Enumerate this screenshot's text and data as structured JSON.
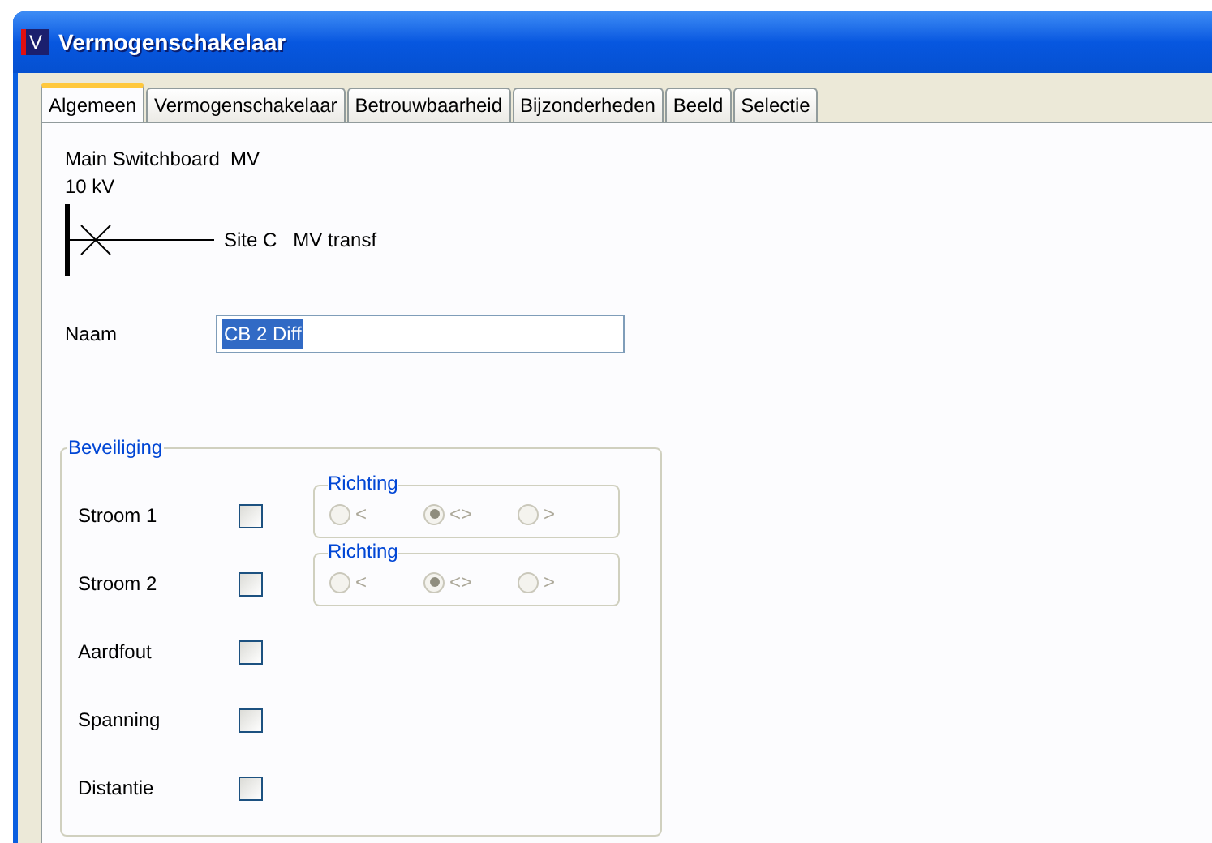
{
  "window": {
    "icon_letter": "V",
    "title": "Vermogenschakelaar"
  },
  "tabs": [
    {
      "label": "Algemeen",
      "selected": true
    },
    {
      "label": "Vermogenschakelaar",
      "selected": false
    },
    {
      "label": "Betrouwbaarheid",
      "selected": false
    },
    {
      "label": "Bijzonderheden",
      "selected": false
    },
    {
      "label": "Beeld",
      "selected": false
    },
    {
      "label": "Selectie",
      "selected": false
    }
  ],
  "header": {
    "switchboard": "Main Switchboard  MV",
    "voltage": "10 kV",
    "connection": "Site C   MV transf"
  },
  "naam": {
    "label": "Naam",
    "value": "CB 2 Diff"
  },
  "beveiliging": {
    "title": "Beveiliging",
    "rows": [
      {
        "label": "Stroom 1",
        "checked": false,
        "richting": {
          "title": "Richting",
          "disabled": true,
          "options": [
            {
              "label": "<",
              "selected": false
            },
            {
              "label": "<>",
              "selected": true
            },
            {
              "label": ">",
              "selected": false
            }
          ]
        }
      },
      {
        "label": "Stroom 2",
        "checked": false,
        "richting": {
          "title": "Richting",
          "disabled": true,
          "options": [
            {
              "label": "<",
              "selected": false
            },
            {
              "label": "<>",
              "selected": true
            },
            {
              "label": ">",
              "selected": false
            }
          ]
        }
      },
      {
        "label": "Aardfout",
        "checked": false
      },
      {
        "label": "Spanning",
        "checked": false
      },
      {
        "label": "Distantie",
        "checked": false
      }
    ]
  }
}
